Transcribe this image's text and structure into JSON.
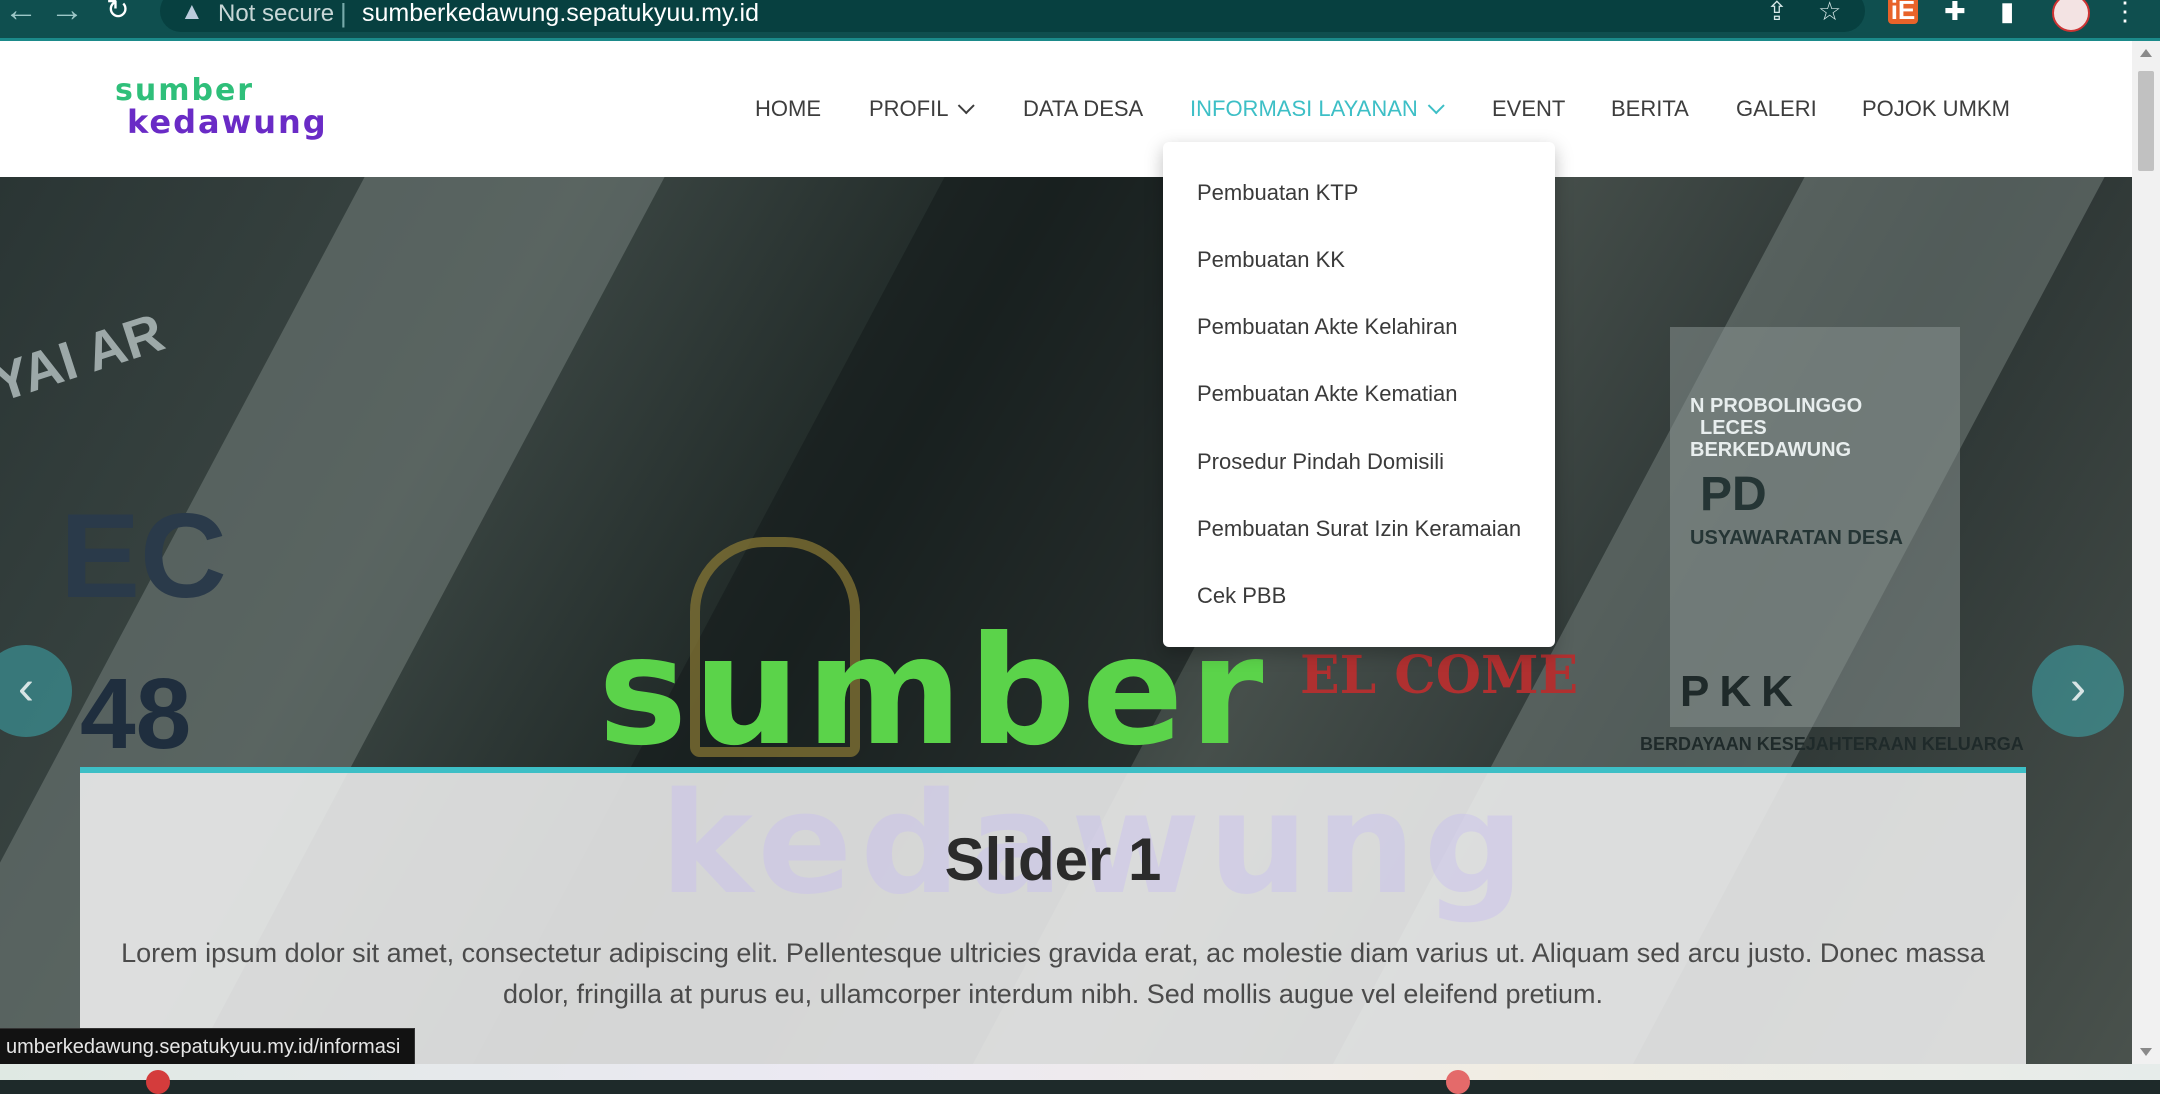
{
  "browser": {
    "security_label": "Not secure",
    "url": "sumberkedawung.sepatukyuu.my.id",
    "status_url": "umberkedawung.sepatukyuu.my.id/informasi",
    "extension_ie_label": "iE"
  },
  "site": {
    "logo": {
      "line1": "sumber",
      "line2": "kedawung"
    },
    "nav": [
      {
        "label": "HOME",
        "has_dropdown": false,
        "active": false
      },
      {
        "label": "PROFIL",
        "has_dropdown": true,
        "active": false
      },
      {
        "label": "DATA DESA",
        "has_dropdown": false,
        "active": false
      },
      {
        "label": "INFORMASI LAYANAN",
        "has_dropdown": true,
        "active": true
      },
      {
        "label": "EVENT",
        "has_dropdown": false,
        "active": false
      },
      {
        "label": "BERITA",
        "has_dropdown": false,
        "active": false
      },
      {
        "label": "GALERI",
        "has_dropdown": false,
        "active": false
      },
      {
        "label": "POJOK UMKM",
        "has_dropdown": false,
        "active": false
      }
    ],
    "dropdown_items": [
      "Pembuatan KTP",
      "Pembuatan KK",
      "Pembuatan Akte Kelahiran",
      "Pembuatan Akte Kematian",
      "Prosedur Pindah Domisili",
      "Pembuatan Surat Izin Keramaian",
      "Cek PBB"
    ]
  },
  "hero": {
    "title": "Slider 1",
    "text": "Lorem ipsum dolor sit amet, consectetur adipiscing elit. Pellentesque ultricies gravida erat, ac molestie diam varius ut. Aliquam sed arcu justo. Donec massa dolor, fringilla at purus eu, ullamcorper interdum nibh. Sed mollis augue vel eleifend pretium.",
    "logo_text": "sumber",
    "background_text": {
      "kyai": "YAI AR",
      "ec": "EC",
      "num": "48",
      "probolinggo": "N PROBOLINGGO",
      "leces": "LECES",
      "desa": "BERKEDAWUNG",
      "bpd": "PD",
      "musya": "USYAWARATAN DESA",
      "pkk": "PKK",
      "pkk_sub": "BERDAYAAN KESEJAHTERAAN KELUARGA",
      "welcome": "EL COME"
    }
  },
  "colors": {
    "accent": "#3dbfc6",
    "chrome": "#0f4f4f",
    "logo_green": "#5bd34a",
    "logo_purple": "#6a2bc6"
  },
  "icons": {
    "back": "arrow-left-icon",
    "forward": "arrow-right-icon",
    "reload": "reload-icon",
    "warning": "warning-icon",
    "share": "share-icon",
    "star": "star-icon",
    "puzzle": "puzzle-icon",
    "sidebar": "sidebar-icon",
    "menu": "kebab-menu-icon",
    "prev": "chevron-left-icon",
    "next": "chevron-right-icon"
  }
}
